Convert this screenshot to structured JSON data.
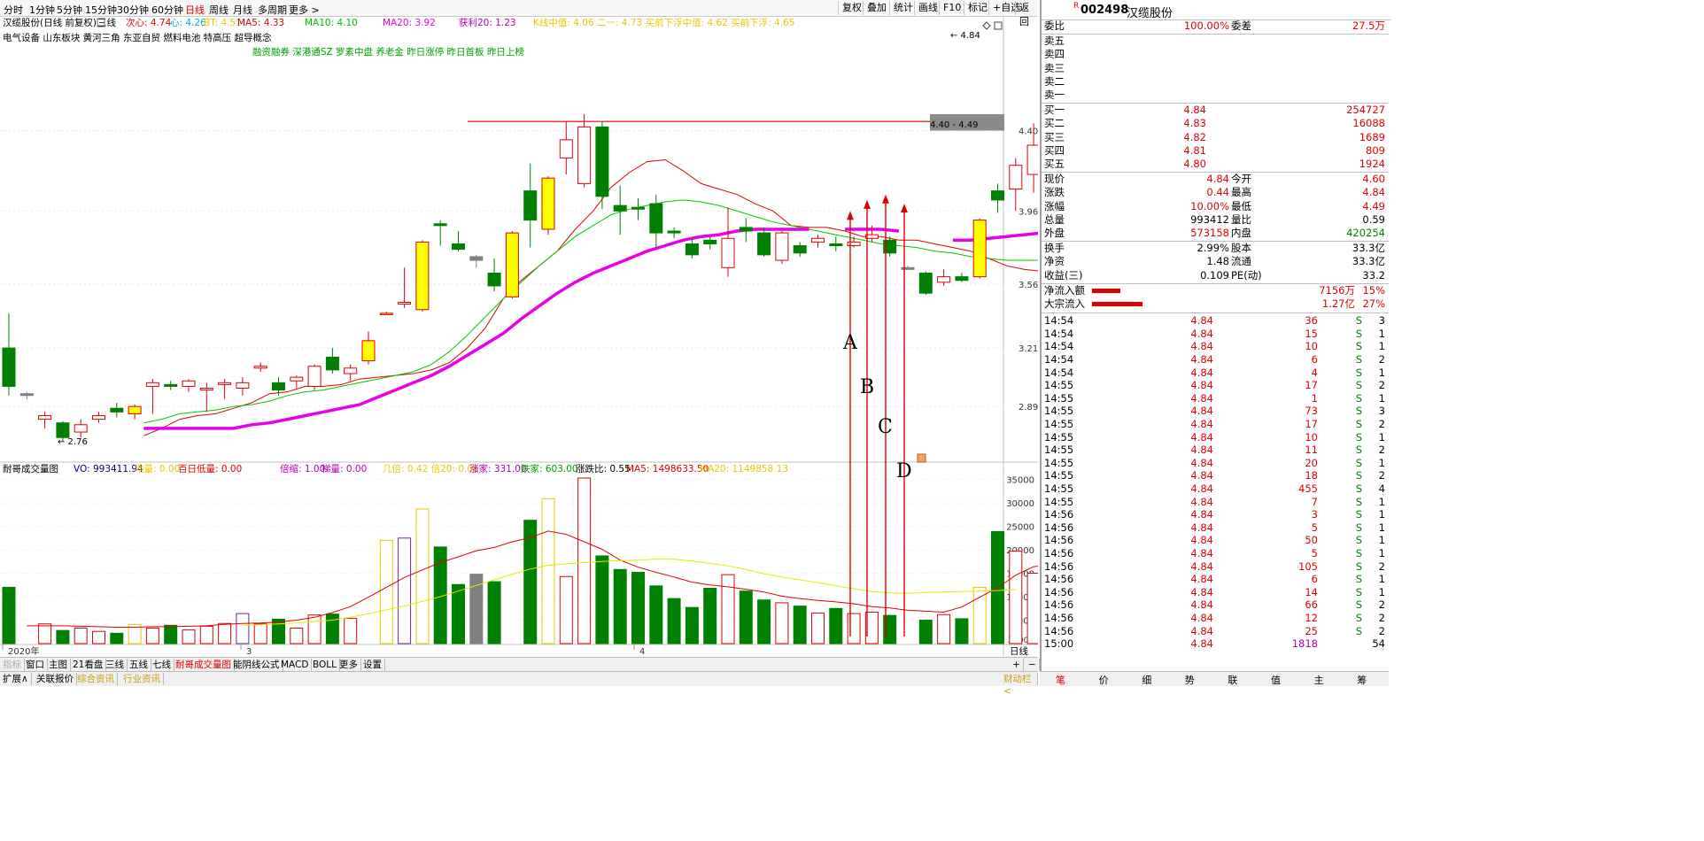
{
  "periods": [
    "分时",
    "1分钟",
    "5分钟",
    "15分钟",
    "30分钟",
    "60分钟",
    "日线",
    "周线",
    "月线",
    "多周期",
    "更多 >"
  ],
  "active_period": "日线",
  "toolbar_buttons": [
    "复权",
    "叠加",
    "统计",
    "画线",
    "F10",
    "标记",
    "+自选",
    "返回"
  ],
  "main_legend": {
    "title": "汉缆股份(日线 前复权)",
    "sanxian": "三线",
    "cixin": "次心: 4.74",
    "xin": "心: 4.26",
    "bt": "BT: 4.51",
    "ma5": "MA5: 4.33",
    "ma10": "MA10: 4.10",
    "ma20": "MA20: 3.92",
    "huoli": "获利20: 1.23",
    "misc": "K线中值: 4.06  二一: 4.73  买前下浮中值: 4.62  买前下浮: 4.65"
  },
  "tags_line1": "电气设备      山东板块      黄河三角 东亚自贸 燃料电池 特高压 超导概念",
  "tags_line2": "融资融券 深港通SZ 罗素中盘 养老金 昨日涨停 昨日首板 昨日上榜",
  "price_axis": [
    "4.40",
    "3.96",
    "3.56",
    "3.21",
    "2.89"
  ],
  "price_annotations": {
    "high": "4.84",
    "low": "2.76",
    "range": "4.40 - 4.49"
  },
  "arrow_labels": [
    "A",
    "B",
    "C",
    "D"
  ],
  "volume_legend": {
    "title": "耐哥成交量图",
    "vo": "VO: 993411.94",
    "lowvol": "地量: 0.00",
    "baili": "百日低量: 0.00",
    "beisuo": "倍缩: 1.00",
    "tilang": "梯量: 0.00",
    "jibei": "几倍: 0.42  倍20: 0.06",
    "zhangjia": "涨家: 331.00",
    "diejia": "跌家: 603.00",
    "zdb": "涨跌比: 0.55",
    "ma5": "MA5: 1498633.50",
    "ma20": "MA20: 1149858.13"
  },
  "volume_axis": [
    "35000",
    "30000",
    "25000",
    "20000",
    "15000",
    "10000",
    "5000"
  ],
  "volume_unit": "X100",
  "date_labels": [
    "2020年",
    "3",
    "4"
  ],
  "bottom_tabs": [
    "指标",
    "窗口",
    "主图",
    "21看盘",
    "三线",
    "五线",
    "七线",
    "耐哥成交量图",
    "能阴线公式",
    "MACD",
    "BOLL",
    "更多",
    "设置"
  ],
  "bottom_tabs2": [
    "扩展∧",
    "关联报价",
    "综合资讯",
    "行业资讯"
  ],
  "right_misc": {
    "rixian": "日线",
    "plus": "+",
    "minus": "−",
    "link": "财动栏 <"
  },
  "stock": {
    "code": "002498",
    "name": "汉缆股份",
    "marker": "R"
  },
  "weibi": {
    "label": "委比",
    "value": "100.00%",
    "label2": "委差",
    "value2": "27.5万"
  },
  "asks": [
    "卖五",
    "卖四",
    "卖三",
    "卖二",
    "卖一"
  ],
  "bids": [
    {
      "label": "买一",
      "price": "4.84",
      "vol": "254727"
    },
    {
      "label": "买二",
      "price": "4.83",
      "vol": "16088"
    },
    {
      "label": "买三",
      "price": "4.82",
      "vol": "1689"
    },
    {
      "label": "买四",
      "price": "4.81",
      "vol": "809"
    },
    {
      "label": "买五",
      "price": "4.80",
      "vol": "1924"
    }
  ],
  "quote": [
    {
      "l1": "现价",
      "v1": "4.84",
      "l2": "今开",
      "v2": "4.60"
    },
    {
      "l1": "涨跌",
      "v1": "0.44",
      "l2": "最高",
      "v2": "4.84"
    },
    {
      "l1": "涨幅",
      "v1": "10.00%",
      "l2": "最低",
      "v2": "4.49"
    },
    {
      "l1": "总量",
      "v1": "993412",
      "l2": "量比",
      "v2": "0.59"
    },
    {
      "l1": "外盘",
      "v1": "573158",
      "l2": "内盘",
      "v2": "420254"
    }
  ],
  "fund": [
    {
      "l1": "换手",
      "v1": "2.99%",
      "l2": "股本",
      "v2": "33.3亿"
    },
    {
      "l1": "净资",
      "v1": "1.48",
      "l2": "流通",
      "v2": "33.3亿"
    },
    {
      "l1": "收益(三)",
      "v1": "0.109",
      "l2": "PE(动)",
      "v2": "33.2"
    }
  ],
  "flow": [
    {
      "label": "净流入额",
      "amount": "7156万",
      "pct": "15%",
      "bar": 0.15
    },
    {
      "label": "大宗流入",
      "amount": "1.27亿",
      "pct": "27%",
      "bar": 0.27
    }
  ],
  "ticks": [
    [
      "14:54",
      "4.84",
      "36",
      "S",
      "3"
    ],
    [
      "14:54",
      "4.84",
      "15",
      "S",
      "1"
    ],
    [
      "14:54",
      "4.84",
      "10",
      "S",
      "1"
    ],
    [
      "14:54",
      "4.84",
      "6",
      "S",
      "2"
    ],
    [
      "14:54",
      "4.84",
      "4",
      "S",
      "1"
    ],
    [
      "14:55",
      "4.84",
      "17",
      "S",
      "2"
    ],
    [
      "14:55",
      "4.84",
      "1",
      "S",
      "1"
    ],
    [
      "14:55",
      "4.84",
      "73",
      "S",
      "3"
    ],
    [
      "14:55",
      "4.84",
      "17",
      "S",
      "2"
    ],
    [
      "14:55",
      "4.84",
      "10",
      "S",
      "1"
    ],
    [
      "14:55",
      "4.84",
      "11",
      "S",
      "2"
    ],
    [
      "14:55",
      "4.84",
      "20",
      "S",
      "1"
    ],
    [
      "14:55",
      "4.84",
      "18",
      "S",
      "2"
    ],
    [
      "14:55",
      "4.84",
      "455",
      "S",
      "4"
    ],
    [
      "14:55",
      "4.84",
      "7",
      "S",
      "1"
    ],
    [
      "14:56",
      "4.84",
      "3",
      "S",
      "1"
    ],
    [
      "14:56",
      "4.84",
      "5",
      "S",
      "1"
    ],
    [
      "14:56",
      "4.84",
      "50",
      "S",
      "1"
    ],
    [
      "14:56",
      "4.84",
      "5",
      "S",
      "1"
    ],
    [
      "14:56",
      "4.84",
      "105",
      "S",
      "2"
    ],
    [
      "14:56",
      "4.84",
      "6",
      "S",
      "1"
    ],
    [
      "14:56",
      "4.84",
      "14",
      "S",
      "1"
    ],
    [
      "14:56",
      "4.84",
      "66",
      "S",
      "2"
    ],
    [
      "14:56",
      "4.84",
      "12",
      "S",
      "2"
    ],
    [
      "14:56",
      "4.84",
      "25",
      "S",
      "2"
    ],
    [
      "15:00",
      "4.84",
      "1818",
      "",
      "54"
    ]
  ],
  "rp_tabs": [
    "笔",
    "价",
    "细",
    "势",
    "联",
    "值",
    "主",
    "筹"
  ],
  "chart_data": {
    "type": "candlestick",
    "price_range": [
      2.6,
      4.95
    ],
    "volume_range": [
      0,
      37000
    ],
    "candles": [
      [
        3.21,
        3.4,
        2.95,
        3.0,
        12000,
        "s"
      ],
      [
        2.95,
        2.97,
        2.93,
        2.96,
        0,
        "d"
      ],
      [
        2.82,
        2.86,
        2.77,
        2.84,
        4200,
        "u"
      ],
      [
        2.8,
        2.81,
        2.7,
        2.72,
        2800,
        "s"
      ],
      [
        2.75,
        2.82,
        2.72,
        2.79,
        3300,
        "u"
      ],
      [
        2.82,
        2.86,
        2.8,
        2.84,
        2600,
        "u"
      ],
      [
        2.88,
        2.91,
        2.83,
        2.86,
        2200,
        "s"
      ],
      [
        2.85,
        2.9,
        2.82,
        2.89,
        4100,
        "y"
      ],
      [
        3.0,
        3.04,
        2.85,
        3.02,
        3300,
        "u"
      ],
      [
        3.0,
        3.03,
        2.98,
        3.01,
        3900,
        "s"
      ],
      [
        3.03,
        3.04,
        2.97,
        3.0,
        2900,
        "u"
      ],
      [
        2.99,
        3.02,
        2.86,
        2.98,
        3700,
        "u"
      ],
      [
        3.01,
        3.04,
        2.93,
        3.02,
        4300,
        "u"
      ],
      [
        3.02,
        3.05,
        2.95,
        2.99,
        6400,
        "p"
      ],
      [
        3.11,
        3.13,
        3.08,
        3.1,
        4200,
        "u"
      ],
      [
        3.02,
        3.05,
        2.95,
        2.98,
        5200,
        "s"
      ],
      [
        3.03,
        3.06,
        2.99,
        3.05,
        3300,
        "u"
      ],
      [
        3.11,
        3.12,
        2.98,
        3.0,
        6100,
        "u"
      ],
      [
        3.16,
        3.21,
        3.07,
        3.09,
        6300,
        "s"
      ],
      [
        3.07,
        3.12,
        3.03,
        3.1,
        5400,
        "u"
      ],
      [
        3.25,
        3.3,
        3.12,
        3.14,
        0,
        "y"
      ],
      [
        3.4,
        3.41,
        3.4,
        3.4,
        22000,
        "y"
      ],
      [
        3.45,
        3.65,
        3.43,
        3.46,
        22500,
        "p"
      ],
      [
        3.79,
        3.8,
        3.41,
        3.42,
        28700,
        "y"
      ],
      [
        3.89,
        3.91,
        3.77,
        3.88,
        20600,
        "s"
      ],
      [
        3.78,
        3.85,
        3.74,
        3.75,
        12600,
        "s"
      ],
      [
        3.69,
        3.72,
        3.65,
        3.71,
        14800,
        "d"
      ],
      [
        3.62,
        3.7,
        3.52,
        3.55,
        13200,
        "s"
      ],
      [
        3.84,
        3.85,
        3.48,
        3.49,
        0,
        "y"
      ],
      [
        4.07,
        4.22,
        3.76,
        3.91,
        26300,
        "s"
      ],
      [
        4.14,
        4.15,
        3.83,
        3.86,
        30900,
        "y"
      ],
      [
        4.25,
        4.45,
        4.16,
        4.35,
        14300,
        "u"
      ],
      [
        4.42,
        4.49,
        4.09,
        4.11,
        35300,
        "u"
      ],
      [
        4.42,
        4.45,
        3.97,
        4.04,
        18700,
        "s"
      ],
      [
        3.99,
        4.1,
        3.83,
        3.96,
        15800,
        "s"
      ],
      [
        3.98,
        4.03,
        3.91,
        3.97,
        15200,
        "s"
      ],
      [
        4.0,
        4.05,
        3.76,
        3.84,
        12300,
        "s"
      ],
      [
        3.85,
        3.87,
        3.81,
        3.84,
        9600,
        "s"
      ],
      [
        3.78,
        3.81,
        3.7,
        3.72,
        7700,
        "s"
      ],
      [
        3.78,
        3.82,
        3.75,
        3.8,
        11800,
        "s"
      ],
      [
        3.81,
        3.98,
        3.6,
        3.65,
        14700,
        "u"
      ],
      [
        3.87,
        3.92,
        3.79,
        3.85,
        11200,
        "s"
      ],
      [
        3.84,
        3.87,
        3.71,
        3.72,
        9300,
        "s"
      ],
      [
        3.84,
        3.85,
        3.67,
        3.69,
        8700,
        "u"
      ],
      [
        3.73,
        3.79,
        3.71,
        3.77,
        8000,
        "s"
      ],
      [
        3.81,
        3.83,
        3.76,
        3.79,
        6500,
        "u"
      ],
      [
        3.77,
        3.82,
        3.74,
        3.78,
        7500,
        "s"
      ],
      [
        3.77,
        3.82,
        3.76,
        3.79,
        6400,
        "u"
      ],
      [
        3.83,
        3.88,
        3.79,
        3.81,
        6700,
        "u"
      ],
      [
        3.8,
        3.82,
        3.71,
        3.73,
        6000,
        "s"
      ],
      [
        3.64,
        3.66,
        3.64,
        3.65,
        0,
        "d"
      ],
      [
        3.62,
        3.63,
        3.5,
        3.51,
        5000,
        "s"
      ],
      [
        3.6,
        3.64,
        3.55,
        3.57,
        6200,
        "u"
      ],
      [
        3.6,
        3.62,
        3.57,
        3.58,
        5300,
        "s"
      ],
      [
        3.91,
        3.92,
        3.59,
        3.6,
        12000,
        "y"
      ],
      [
        4.02,
        4.11,
        3.95,
        4.07,
        23900,
        "s"
      ],
      [
        4.21,
        4.25,
        3.96,
        4.08,
        19700,
        "u"
      ],
      [
        4.32,
        4.44,
        4.06,
        4.16,
        15000,
        "u"
      ],
      [
        4.18,
        4.3,
        4.16,
        4.19,
        13400,
        "u"
      ],
      [
        4.06,
        4.15,
        4.0,
        4.11,
        11700,
        "s"
      ],
      [
        4.4,
        4.49,
        4.07,
        4.09,
        23900,
        "y"
      ],
      [
        4.84,
        4.84,
        4.49,
        4.6,
        9900,
        "m"
      ]
    ],
    "ma_lines": [
      {
        "name": "MA5",
        "color": "#e00000",
        "values": [
          2.73,
          2.77,
          2.82,
          2.84,
          2.85,
          2.88,
          2.91,
          2.96,
          2.97,
          3.0,
          3.0,
          3.01,
          3.04,
          3.05,
          3.06,
          3.07,
          3.09,
          3.13,
          3.21,
          3.32,
          3.48,
          3.58,
          3.66,
          3.74,
          3.86,
          3.96,
          4.09,
          4.17,
          4.23,
          4.24,
          4.18,
          4.11,
          4.08,
          4.05,
          4.0,
          3.96,
          3.88,
          3.87,
          3.87,
          3.85,
          3.82,
          3.82,
          3.8,
          3.8,
          3.78,
          3.76,
          3.74,
          3.7,
          3.66,
          3.64,
          3.63,
          3.62,
          3.64,
          3.7,
          3.78,
          3.89,
          4.0,
          4.11,
          4.18,
          4.25,
          4.33
        ]
      },
      {
        "name": "MA10",
        "color": "#00c800",
        "values": [
          2.8,
          2.82,
          2.85,
          2.86,
          2.87,
          2.89,
          2.9,
          2.92,
          2.95,
          2.97,
          2.98,
          3.0,
          3.02,
          3.04,
          3.06,
          3.08,
          3.12,
          3.19,
          3.28,
          3.38,
          3.48,
          3.57,
          3.66,
          3.74,
          3.82,
          3.88,
          3.94,
          3.97,
          3.99,
          4.01,
          4.02,
          4.01,
          3.99,
          3.96,
          3.93,
          3.9,
          3.88,
          3.86,
          3.84,
          3.82,
          3.8,
          3.78,
          3.77,
          3.76,
          3.74,
          3.73,
          3.71,
          3.7,
          3.69,
          3.69,
          3.69,
          3.71,
          3.75,
          3.8,
          3.86,
          3.93,
          3.98,
          4.01,
          4.04,
          4.1
        ]
      },
      {
        "name": "MA20",
        "color": "#e800e8",
        "values": [
          2.77,
          2.77,
          2.77,
          2.77,
          2.77,
          2.77,
          2.79,
          2.8,
          2.82,
          2.84,
          2.86,
          2.88,
          2.9,
          2.94,
          2.98,
          3.02,
          3.06,
          3.11,
          3.17,
          3.23,
          3.29,
          3.37,
          3.44,
          3.51,
          3.57,
          3.62,
          3.66,
          3.7,
          3.74,
          3.77,
          3.8,
          3.82,
          3.83,
          3.85,
          3.86,
          3.86,
          3.86,
          3.86,
          null,
          3.86,
          3.86,
          3.86,
          3.85,
          null,
          null,
          3.8,
          3.8,
          3.81,
          3.82,
          3.83,
          3.84,
          3.86,
          3.88,
          3.92
        ]
      }
    ],
    "volume_ma": [
      {
        "name": "MA5",
        "color": "#e00000",
        "values": [
          3.8,
          3.8,
          3.8,
          3.7,
          3.6,
          3.5,
          3.5,
          3.6,
          3.6,
          3.7,
          3.8,
          4.1,
          4.3,
          4.4,
          4.6,
          5.0,
          5.6,
          6.6,
          7.9,
          9.9,
          12.0,
          14.1,
          15.7,
          17.3,
          18.5,
          19.8,
          20.5,
          21.7,
          22.6,
          24.0,
          23.3,
          21.7,
          20.1,
          17.8,
          16.3,
          15.2,
          14.2,
          13.1,
          12.5,
          12.1,
          11.6,
          11.0,
          10.1,
          9.6,
          9.2,
          8.9,
          8.5,
          7.9,
          7.6,
          7.1,
          6.9,
          6.7,
          7.8,
          9.9,
          11.9,
          14.6,
          16.4,
          16.8,
          16.9,
          15.0
        ]
      },
      {
        "name": "MA20",
        "color": "#e8e800",
        "values": [
          null,
          null,
          null,
          null,
          null,
          null,
          null,
          null,
          null,
          null,
          null,
          null,
          3.9,
          4.0,
          4.2,
          4.4,
          4.7,
          5.0,
          5.6,
          6.4,
          7.2,
          8.0,
          9.0,
          10.0,
          11.2,
          12.4,
          13.6,
          14.8,
          15.9,
          16.7,
          17.0,
          17.3,
          17.5,
          17.7,
          17.8,
          18.0,
          18.0,
          17.6,
          17.1,
          16.6,
          15.8,
          14.9,
          14.2,
          13.6,
          13.0,
          12.3,
          11.7,
          11.1,
          10.8,
          10.7,
          10.9,
          11.0,
          11.1,
          11.2,
          11.3,
          11.5
        ]
      }
    ]
  }
}
